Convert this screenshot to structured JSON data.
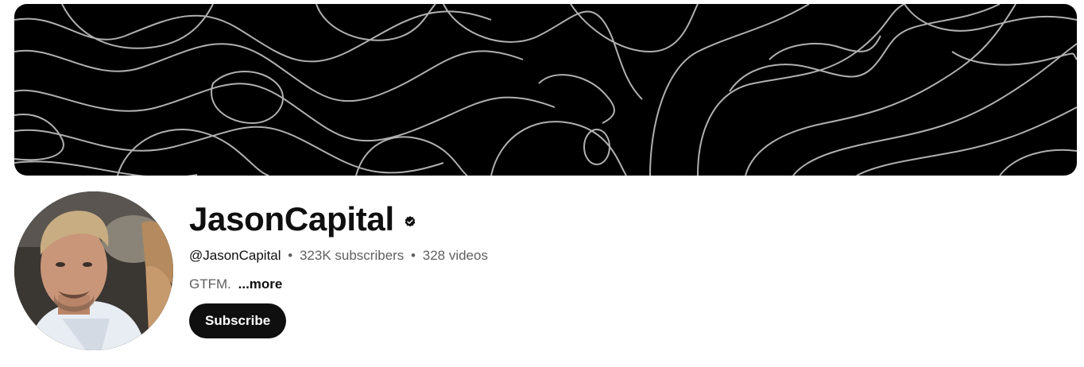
{
  "channel": {
    "name": "JasonCapital",
    "verified": true,
    "handle": "@JasonCapital",
    "subscribers": "323K subscribers",
    "videos": "328 videos",
    "separator": "•",
    "description": "GTFM.",
    "more_label": "...more",
    "subscribe_label": "Subscribe"
  },
  "banner": {
    "style": "topographic-contour-lines",
    "background_color": "#000000",
    "line_color": "#cfcfcf"
  },
  "icons": {
    "verified": "verified-check-icon"
  },
  "colors": {
    "primary_text": "#0f0f0f",
    "secondary_text": "#606060",
    "button_bg": "#0f0f0f",
    "button_text": "#ffffff"
  }
}
